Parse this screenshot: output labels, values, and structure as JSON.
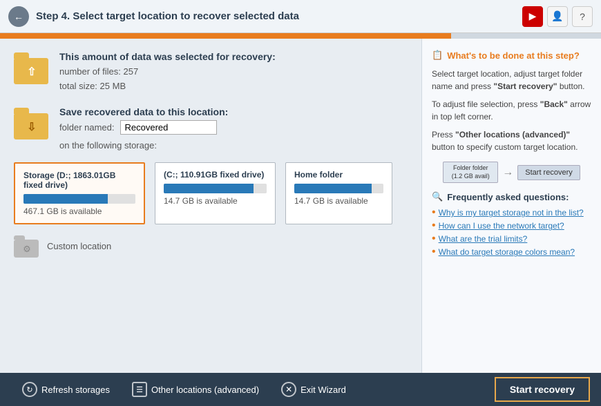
{
  "header": {
    "back_icon": "←",
    "step_label": "Step 4.",
    "title": "Select target location to recover selected data",
    "icons": {
      "youtube": "▶",
      "user": "👤",
      "help": "?"
    }
  },
  "progress": {
    "fill_percent": 75
  },
  "data_section": {
    "title": "This amount of data was selected for recovery:",
    "files_label": "number of files:",
    "files_value": "257",
    "size_label": "total size:",
    "size_value": "25 MB"
  },
  "save_section": {
    "title": "Save recovered data to this location:",
    "folder_label": "folder named:",
    "folder_value": "Recovered",
    "storage_label": "on the following storage:"
  },
  "storages": [
    {
      "id": "storage-d",
      "title": "Storage (D:; 1863.01GB fixed drive)",
      "fill_percent": 75,
      "available": "467.1 GB is available",
      "selected": true
    },
    {
      "id": "storage-c",
      "title": "(C:; 110.91GB fixed drive)",
      "fill_percent": 87,
      "available": "14.7 GB is available",
      "selected": false
    },
    {
      "id": "home-folder",
      "title": "Home folder",
      "fill_percent": 87,
      "available": "14.7 GB is available",
      "selected": false
    }
  ],
  "custom_location": {
    "label": "Custom location"
  },
  "right_panel": {
    "what_title": "What's to be done at this step?",
    "what_icon": "📋",
    "desc1": "Select target location, adjust target folder name and press \"Start recovery\" button.",
    "desc2": "To adjust file selection, press \"Back\" arrow in top left corner.",
    "desc3": "Press \"Other locations (advanced)\" button to specify custom target location.",
    "preview_folder_label": "Folder folder\n(1.2 GB avail)",
    "preview_arrow": "→",
    "preview_start": "Start recovery",
    "faq_title": "Frequently asked questions:",
    "faq_icon": "🔍",
    "faq_items": [
      "Why is my target storage not in the list?",
      "How can I use the network target?",
      "What are the trial limits?",
      "What do target storage colors mean?"
    ]
  },
  "footer": {
    "refresh_label": "Refresh storages",
    "other_label": "Other locations (advanced)",
    "exit_label": "Exit Wizard",
    "start_label": "Start recovery"
  }
}
